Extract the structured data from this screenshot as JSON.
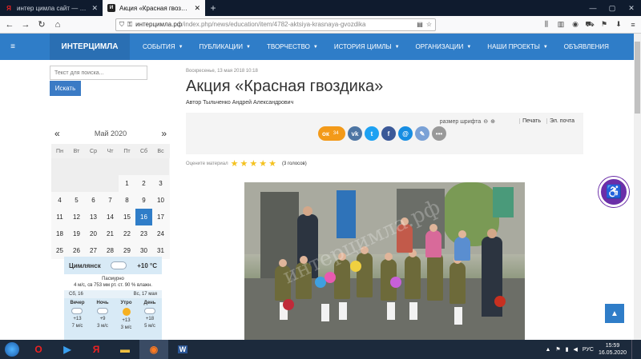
{
  "browser": {
    "tabs": [
      {
        "title": "интер цимла сайт — Яндекс:",
        "icon": "yandex-icon",
        "active": false
      },
      {
        "title": "Акция «Красная гвоздика»",
        "icon": "site-icon",
        "active": true
      }
    ],
    "new_tab": "+",
    "url_main": "интерцимла.рф",
    "url_path": "/index.php/news/education/item/4782-aktsiya-krasnaya-gvozdika"
  },
  "site": {
    "brand": "ИНТЕРЦИМЛА",
    "menu": [
      "СОБЫТИЯ",
      "ПУБЛИКАЦИИ",
      "ТВОРЧЕСТВО",
      "ИСТОРИЯ ЦИМЛЫ",
      "ОРГАНИЗАЦИИ",
      "НАШИ ПРОЕКТЫ",
      "ОБЪЯВЛЕНИЯ"
    ]
  },
  "search": {
    "placeholder": "Текст для поиска...",
    "button": "Искать"
  },
  "calendar": {
    "month": "Май 2020",
    "prev": "«",
    "next": "»",
    "weekdays": [
      "Пн",
      "Вт",
      "Ср",
      "Чт",
      "Пт",
      "Сб",
      "Вс"
    ],
    "rows": [
      [
        "",
        "",
        "",
        "",
        "",
        "",
        ""
      ],
      [
        "",
        "",
        "",
        "",
        "1",
        "2",
        "3"
      ],
      [
        "4",
        "5",
        "6",
        "7",
        "8",
        "9",
        "10"
      ],
      [
        "11",
        "12",
        "13",
        "14",
        "15",
        "16",
        "17"
      ],
      [
        "18",
        "19",
        "20",
        "21",
        "22",
        "23",
        "24"
      ],
      [
        "25",
        "26",
        "27",
        "28",
        "29",
        "30",
        "31"
      ]
    ],
    "today": "16"
  },
  "weather": {
    "city": "Цимлянск",
    "temp": "+10 °C",
    "desc": "Пасмурно",
    "details": "4 м/с, св  753 мм рт. ст.  90 % влажн.",
    "day1": "Сб, 16",
    "day2": "Вс, 17 мая",
    "periods": [
      {
        "name": "Вечер",
        "temp": "+13",
        "wind": "7 м/с",
        "icon": "cloud-icon"
      },
      {
        "name": "Ночь",
        "temp": "+9",
        "wind": "3 м/с",
        "icon": "cloud-icon"
      },
      {
        "name": "Утро",
        "temp": "+13",
        "wind": "3 м/с",
        "icon": "sun-icon"
      },
      {
        "name": "День",
        "temp": "+18",
        "wind": "5 м/с",
        "icon": "cloud-icon"
      }
    ]
  },
  "article": {
    "date": "Воскресенье, 13 мая 2018 10:18",
    "title": "Акция «Красная гвоздика»",
    "author_label": "Автор",
    "author": "Тыльченко Андрей Александрович",
    "font_size_label": "размер шрифта",
    "print": "Печать",
    "email": "Эл. почта",
    "ok_count": "34",
    "rating_label": "Оцените материал",
    "votes": "(3 голосов)",
    "watermark": "интерцимла.рф"
  },
  "taskbar": {
    "lang": "РУС",
    "time": "15:59",
    "date": "16.05.2020"
  }
}
